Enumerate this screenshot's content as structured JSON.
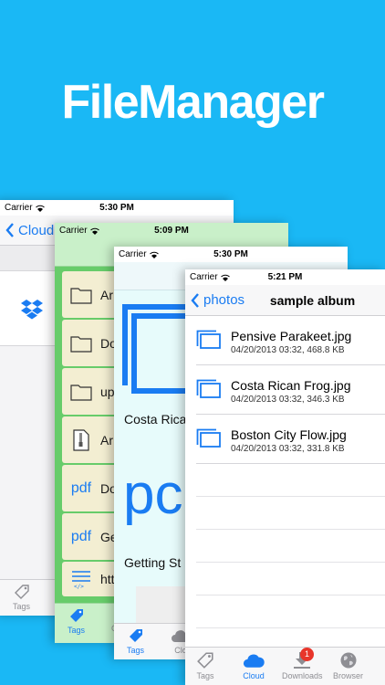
{
  "app_title": "FileManager",
  "screen1": {
    "carrier": "Carrier",
    "time": "5:30 PM",
    "back_label": "Cloud",
    "tab_tags": "Tags"
  },
  "screen2": {
    "carrier": "Carrier",
    "time": "5:09 PM",
    "rows": [
      {
        "icon": "folder-icon",
        "label": "Ar"
      },
      {
        "icon": "folder-icon",
        "label": "Do"
      },
      {
        "icon": "folder-icon",
        "label": "up"
      },
      {
        "icon": "zip-icon",
        "label": "Ar"
      },
      {
        "icon": "pdf",
        "pdf_text": "pdf",
        "label": "Do"
      },
      {
        "icon": "pdf",
        "pdf_text": "pdf",
        "label": "Ge"
      },
      {
        "icon": "html-icon",
        "label": "htt"
      }
    ],
    "tab_tags": "Tags",
    "tab_cloud_partial": "C"
  },
  "screen3": {
    "carrier": "Carrier",
    "time": "5:30 PM",
    "text1": "Costa Rica",
    "big_text": "pc",
    "text2": "Getting St",
    "tab_tags": "Tags",
    "tab_cloud_partial": "Clo"
  },
  "screen4": {
    "carrier": "Carrier",
    "time": "5:21 PM",
    "back_label": "photos",
    "title": "sample album",
    "files": [
      {
        "name": "Pensive Parakeet.jpg",
        "meta": "04/20/2013 03:32, 468.8 KB"
      },
      {
        "name": "Costa Rican Frog.jpg",
        "meta": "04/20/2013 03:32, 346.3 KB"
      },
      {
        "name": "Boston City Flow.jpg",
        "meta": "04/20/2013 03:32, 331.8 KB"
      }
    ],
    "tabs": {
      "tags": "Tags",
      "cloud": "Cloud",
      "downloads": "Downloads",
      "downloads_badge": "1",
      "browser": "Browser"
    },
    "accent": "#1a7cf2"
  }
}
